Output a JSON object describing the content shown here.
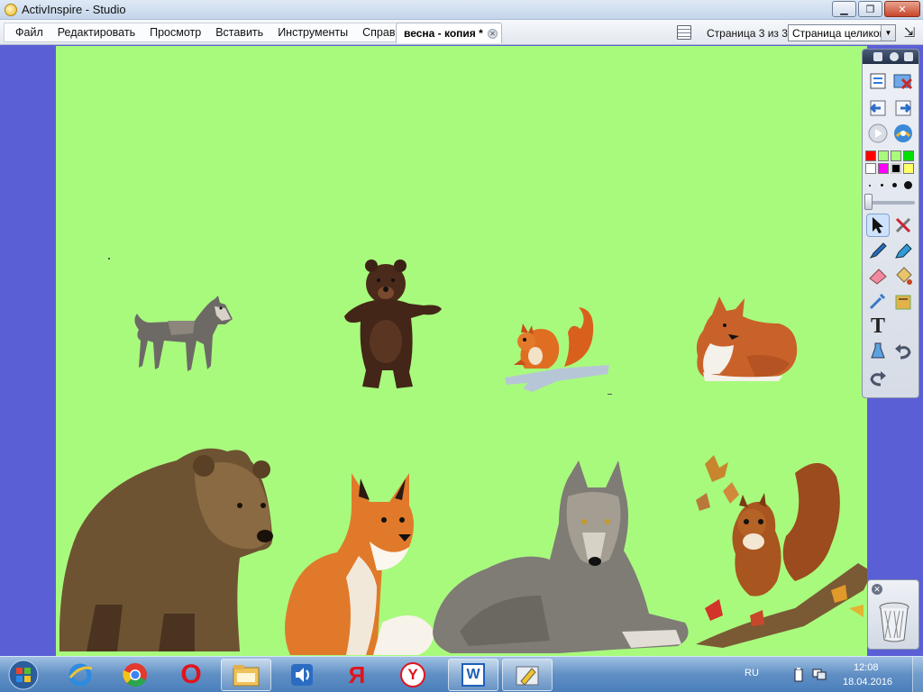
{
  "window": {
    "title": "ActivInspire - Studio",
    "controls": {
      "minimize": "▁",
      "maximize": "❐",
      "close": "✕"
    }
  },
  "menu": {
    "items": [
      "Файл",
      "Редактировать",
      "Просмотр",
      "Вставить",
      "Инструменты",
      "Справка"
    ]
  },
  "document_tab": {
    "label": "весна - копия *"
  },
  "page_nav": {
    "counter": "Страница 3 из 3",
    "zoom_value": "Страница целиком",
    "zoom_arrow": "▼"
  },
  "canvas": {
    "background": "#a8fa7d",
    "animals": [
      {
        "name": "wolf",
        "size": "small"
      },
      {
        "name": "bear",
        "size": "small"
      },
      {
        "name": "squirrel",
        "size": "small"
      },
      {
        "name": "fox",
        "size": "small"
      },
      {
        "name": "bear",
        "size": "large"
      },
      {
        "name": "fox",
        "size": "large"
      },
      {
        "name": "wolf",
        "size": "large"
      },
      {
        "name": "squirrel",
        "size": "large"
      }
    ]
  },
  "toolbox": {
    "colors": [
      "#ff0000",
      "#a8fa7d",
      "#a8fa7d",
      "#00e000",
      "#ffffff",
      "#ff00ff",
      "#000000",
      "#ffff66"
    ],
    "tools": [
      "select-icon",
      "tools-icon",
      "pen-icon",
      "highlighter-icon",
      "eraser-icon",
      "fill-icon",
      "color-picker-icon",
      "clipboard-icon",
      "text-icon",
      "clear-icon",
      "undo-icon",
      "redo-icon"
    ],
    "text_tool_glyph": "T"
  },
  "trash": {
    "close_glyph": "✕"
  },
  "taskbar": {
    "apps": [
      "explorer-icon",
      "internet-explorer-icon",
      "chrome-icon",
      "opera-icon",
      "file-manager-icon",
      "speaker-icon",
      "yandex-icon",
      "yandex-browser-icon",
      "word-icon",
      "activinspire-icon"
    ],
    "yandex_glyph": "Я",
    "yandex_browser_glyph": "Y",
    "word_glyph": "W",
    "opera_glyph": "O",
    "language": "RU",
    "time": "12:08",
    "date": "18.04.2016"
  },
  "colors": {
    "accent_side": "#5b5fd6",
    "canvas": "#a8fa7d"
  }
}
